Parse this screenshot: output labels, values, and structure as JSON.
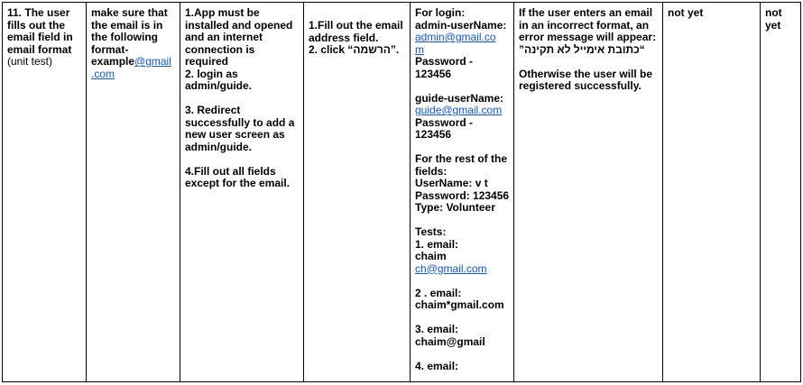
{
  "row": {
    "id": {
      "number": "11.",
      "lines": [
        "The user",
        "fills out the",
        "email field in",
        "email format"
      ],
      "note": "(unit test)"
    },
    "requirement": {
      "lines": [
        "make sure that",
        "the email is in",
        "the following",
        "format-"
      ],
      "example_prefix": "example",
      "example_link_1": "@gmail",
      "example_link_2": ".com"
    },
    "preconditions": {
      "lines_1": [
        "1.App must be",
        "installed and opened",
        "and an internet",
        "connection is",
        "required",
        "2. login as",
        "admin/guide."
      ],
      "lines_2": [
        "3. Redirect",
        "successfully to add a",
        "new user screen as",
        "admin/guide."
      ],
      "lines_3": [
        "4.Fill out all fields",
        "except for the email."
      ]
    },
    "steps": {
      "lines": [
        "1.Fill out the email",
        "address field."
      ],
      "step2_prefix": "2. click “",
      "step2_hebrew": "הרשמה",
      "step2_suffix": "”."
    },
    "test_data": {
      "login_title": "For login:",
      "admin_label": "admin-userName:",
      "admin_email_1": "admin@gmail.co",
      "admin_email_2": "m",
      "admin_password_label": "Password -",
      "admin_password": "123456",
      "guide_label": "guide-userName:",
      "guide_email": "guide@gmail.com",
      "guide_password_label": "Password -",
      "guide_password": "123456",
      "rest_title_1": "For the rest of the",
      "rest_title_2": "fields:",
      "username": "UserName: v t",
      "password": "Password: 123456",
      "type": "Type: Volunteer",
      "tests_title": "Tests:",
      "test1_label": "1. email:",
      "test1_value_1": "chaim",
      "test1_value_2": "ch@gmail.com",
      "test2_label": "2 . email:",
      "test2_value": "chaim*gmail.com",
      "test3_label": "3. email:",
      "test3_value": "chaim@gmail",
      "test4_label": "4. email:"
    },
    "expected": {
      "lines": [
        "If the user enters an email",
        "in an incorrect format, an",
        "error message will appear:"
      ],
      "error_hebrew": "”כתובת אימייל לא תקינה“",
      "otherwise_lines": [
        "Otherwise the user will be",
        "registered successfully."
      ]
    },
    "actual": {
      "text": "not yet"
    },
    "status": {
      "line_1": "not",
      "line_2": "yet"
    }
  }
}
